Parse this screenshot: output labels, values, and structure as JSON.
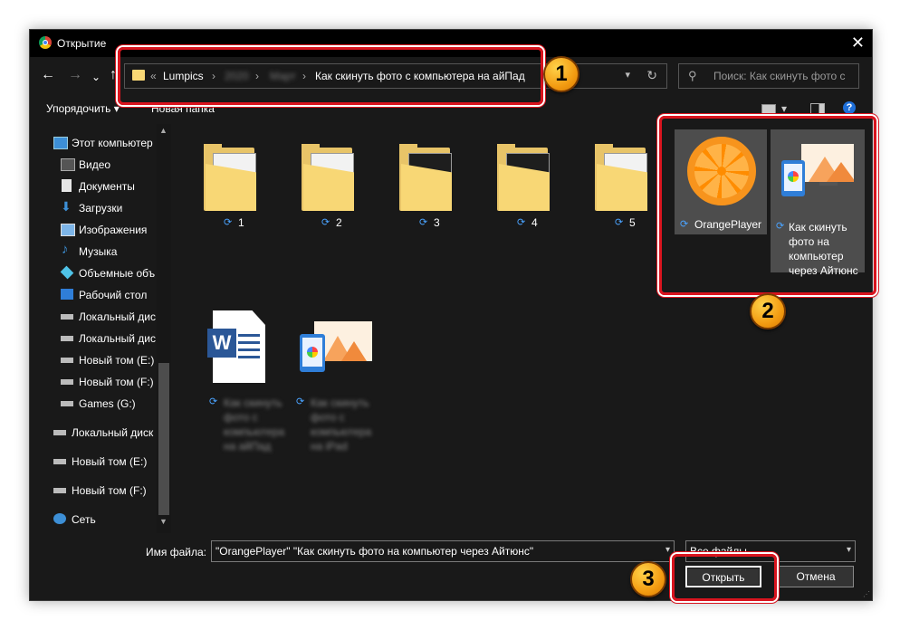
{
  "window": {
    "title": "Открытие",
    "close_glyph": "✕"
  },
  "nav": {
    "back": "←",
    "forward": "→",
    "recent": "⌄",
    "up": "↑"
  },
  "address": {
    "crumbs": [
      "Lumpics",
      "2020",
      "Март",
      "Как скинуть фото с компьютера на айПад"
    ],
    "prefix": "«",
    "separator": "›",
    "refresh_glyph": "↻"
  },
  "search": {
    "placeholder": "Поиск: Как скинуть фото с ..."
  },
  "toolbar": {
    "organize": "Упорядочить",
    "new_folder": "Новая папка",
    "help": "?"
  },
  "sidebar": {
    "items": [
      {
        "label": "Этот компьютер",
        "icon": "computer-icon"
      },
      {
        "label": "Видео",
        "icon": "video-icon"
      },
      {
        "label": "Документы",
        "icon": "documents-icon"
      },
      {
        "label": "Загрузки",
        "icon": "downloads-icon"
      },
      {
        "label": "Изображения",
        "icon": "pictures-icon"
      },
      {
        "label": "Музыка",
        "icon": "music-icon"
      },
      {
        "label": "Объемные объ",
        "icon": "3d-objects-icon"
      },
      {
        "label": "Рабочий стол",
        "icon": "desktop-icon"
      },
      {
        "label": "Локальный дис",
        "icon": "drive-icon"
      },
      {
        "label": "Локальный дис",
        "icon": "drive-icon"
      },
      {
        "label": "Новый том (E:)",
        "icon": "drive-icon"
      },
      {
        "label": "Новый том (F:)",
        "icon": "drive-icon"
      },
      {
        "label": "Games (G:)",
        "icon": "drive-icon"
      },
      {
        "label": "Локальный диск",
        "icon": "drive-icon"
      },
      {
        "label": "Новый том (E:)",
        "icon": "drive-icon"
      },
      {
        "label": "Новый том (F:)",
        "icon": "drive-icon"
      },
      {
        "label": "Сеть",
        "icon": "network-icon"
      }
    ]
  },
  "files": {
    "folders": [
      "1",
      "2",
      "3",
      "4",
      "5"
    ],
    "selected": [
      {
        "name": "OrangePlayer"
      },
      {
        "name": "Как скинуть фото на компьютер через Айтюнс"
      }
    ],
    "blurred": [
      {
        "name": "Как скинуть фото с компьютера на айПад"
      },
      {
        "name": "Как скинуть фото с компьютера на iPad"
      }
    ]
  },
  "footer": {
    "filename_label": "Имя файла:",
    "filename_value": "\"OrangePlayer\" \"Как скинуть фото на компьютер через Айтюнс\"",
    "filetype_value": "Все файлы",
    "open_button": "Открыть",
    "cancel_button": "Отмена"
  },
  "annotations": {
    "badge1": "1",
    "badge2": "2",
    "badge3": "3",
    "highlight_color": "#d9141e",
    "badge_color": "#f39c12"
  }
}
